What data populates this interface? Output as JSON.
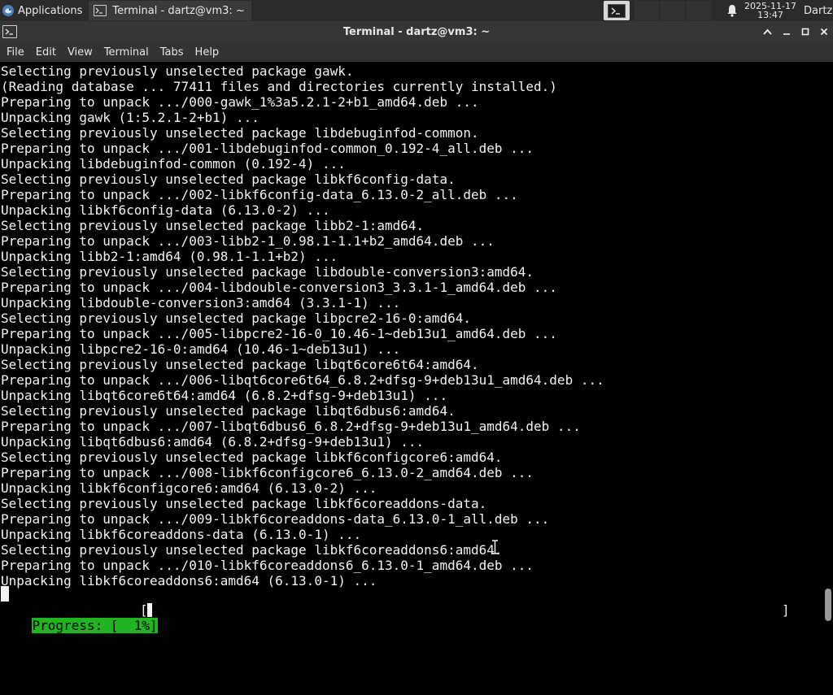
{
  "panel": {
    "applications_label": "Applications",
    "task_label": "Terminal - dartz@vm3: ~",
    "clock_date": "2025-11-17",
    "clock_time": "13:47",
    "user": "Dartz",
    "icons": [
      "xfce-logo-icon",
      "terminal-icon",
      "bell-icon"
    ]
  },
  "window": {
    "title": "Terminal - dartz@vm3: ~",
    "buttons": [
      "maximize-up",
      "minimize",
      "restore",
      "close"
    ]
  },
  "menubar": {
    "items": [
      "File",
      "Edit",
      "View",
      "Terminal",
      "Tabs",
      "Help"
    ]
  },
  "terminal": {
    "lines": [
      "Selecting previously unselected package gawk.",
      "(Reading database ... 77411 files and directories currently installed.)",
      "Preparing to unpack .../000-gawk_1%3a5.2.1-2+b1_amd64.deb ...",
      "Unpacking gawk (1:5.2.1-2+b1) ...",
      "Selecting previously unselected package libdebuginfod-common.",
      "Preparing to unpack .../001-libdebuginfod-common_0.192-4_all.deb ...",
      "Unpacking libdebuginfod-common (0.192-4) ...",
      "Selecting previously unselected package libkf6config-data.",
      "Preparing to unpack .../002-libkf6config-data_6.13.0-2_all.deb ...",
      "Unpacking libkf6config-data (6.13.0-2) ...",
      "Selecting previously unselected package libb2-1:amd64.",
      "Preparing to unpack .../003-libb2-1_0.98.1-1.1+b2_amd64.deb ...",
      "Unpacking libb2-1:amd64 (0.98.1-1.1+b2) ...",
      "Selecting previously unselected package libdouble-conversion3:amd64.",
      "Preparing to unpack .../004-libdouble-conversion3_3.3.1-1_amd64.deb ...",
      "Unpacking libdouble-conversion3:amd64 (3.3.1-1) ...",
      "Selecting previously unselected package libpcre2-16-0:amd64.",
      "Preparing to unpack .../005-libpcre2-16-0_10.46-1~deb13u1_amd64.deb ...",
      "Unpacking libpcre2-16-0:amd64 (10.46-1~deb13u1) ...",
      "Selecting previously unselected package libqt6core6t64:amd64.",
      "Preparing to unpack .../006-libqt6core6t64_6.8.2+dfsg-9+deb13u1_amd64.deb ...",
      "Unpacking libqt6core6t64:amd64 (6.8.2+dfsg-9+deb13u1) ...",
      "Selecting previously unselected package libqt6dbus6:amd64.",
      "Preparing to unpack .../007-libqt6dbus6_6.8.2+dfsg-9+deb13u1_amd64.deb ...",
      "Unpacking libqt6dbus6:amd64 (6.8.2+dfsg-9+deb13u1) ...",
      "Selecting previously unselected package libkf6configcore6:amd64.",
      "Preparing to unpack .../008-libkf6configcore6_6.13.0-2_amd64.deb ...",
      "Unpacking libkf6configcore6:amd64 (6.13.0-2) ...",
      "Selecting previously unselected package libkf6coreaddons-data.",
      "Preparing to unpack .../009-libkf6coreaddons-data_6.13.0-1_all.deb ...",
      "Unpacking libkf6coreaddons-data (6.13.0-1) ...",
      "Selecting previously unselected package libkf6coreaddons6:amd64.",
      "Preparing to unpack .../010-libkf6coreaddons6_6.13.0-1_amd64.deb ...",
      "Unpacking libkf6coreaddons6:amd64 (6.13.0-1) ..."
    ],
    "progress_label": "Progress: [  1%]",
    "progress_percent": 1,
    "bracket_open": "[",
    "bracket_close": "]",
    "colors": {
      "background": "#000000",
      "text": "#f2f2f2",
      "progress": "#22b322"
    }
  }
}
